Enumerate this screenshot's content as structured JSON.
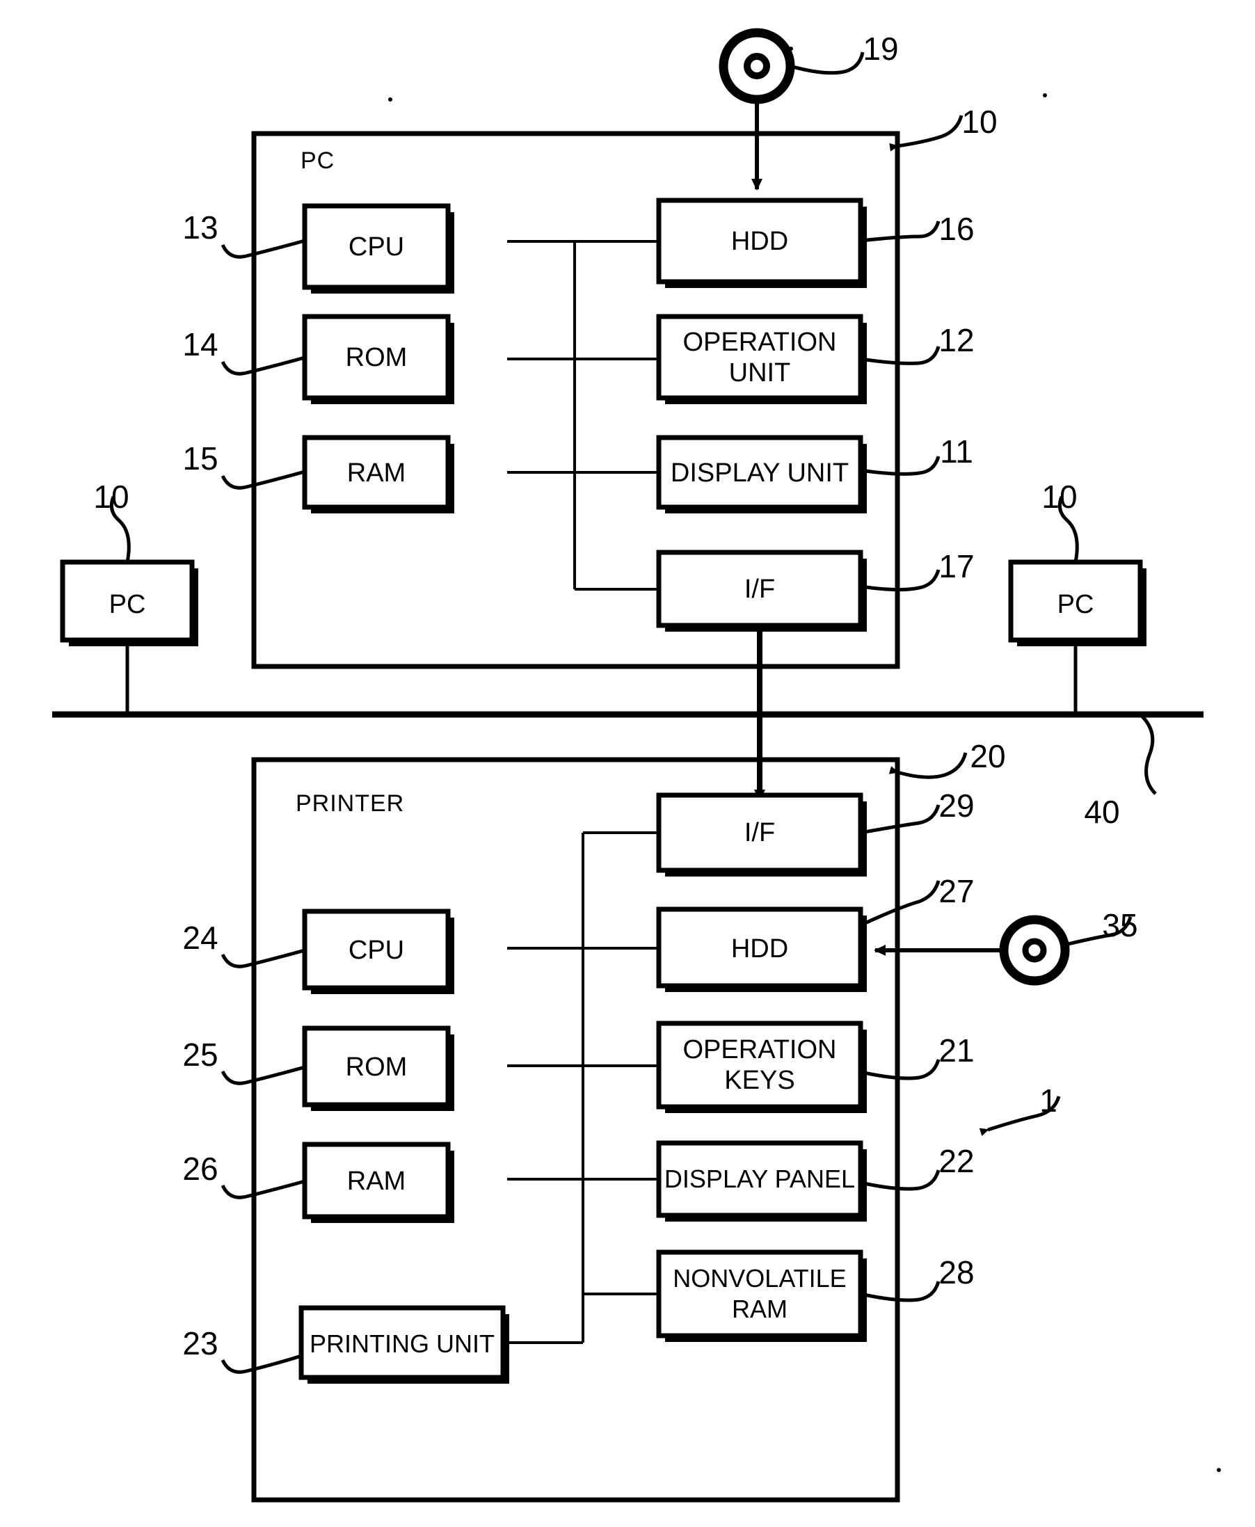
{
  "figure": {
    "type": "patent-block-diagram",
    "background_color": "#ffffff",
    "line_color": "#000000",
    "system_ref": "1",
    "network": {
      "label": "40",
      "name": "network-bus-line"
    }
  },
  "pc_host": {
    "section_label": "PC",
    "ref": "10",
    "blocks": [
      {
        "id": "cpu",
        "label": "CPU",
        "ref": "13",
        "ref_side": "left"
      },
      {
        "id": "rom",
        "label": "ROM",
        "ref": "14",
        "ref_side": "left"
      },
      {
        "id": "ram",
        "label": "RAM",
        "ref": "15",
        "ref_side": "left"
      },
      {
        "id": "hdd",
        "label": "HDD",
        "ref": "16",
        "ref_side": "right"
      },
      {
        "id": "opunit",
        "label": "OPERATION UNIT",
        "ref": "12",
        "ref_side": "right"
      },
      {
        "id": "disp",
        "label": "DISPLAY UNIT",
        "ref": "11",
        "ref_side": "right"
      },
      {
        "id": "if",
        "label": "I/F",
        "ref": "17",
        "ref_side": "right"
      }
    ],
    "media": {
      "ref": "19",
      "icon": "storage-medium-disc-icon",
      "target": "HDD"
    }
  },
  "pc_left": {
    "label": "PC",
    "ref": "10"
  },
  "pc_right": {
    "label": "PC",
    "ref": "10"
  },
  "printer": {
    "section_label": "PRINTER",
    "ref": "20",
    "blocks": [
      {
        "id": "if",
        "label": "I/F",
        "ref": "29",
        "ref_side": "right"
      },
      {
        "id": "hdd",
        "label": "HDD",
        "ref": "27",
        "ref_side": "right"
      },
      {
        "id": "opkeys",
        "label": "OPERATION KEYS",
        "ref": "21",
        "ref_side": "right"
      },
      {
        "id": "panel",
        "label": "DISPLAY PANEL",
        "ref": "22",
        "ref_side": "right"
      },
      {
        "id": "nvram",
        "label": "NONVOLATILE RAM",
        "ref": "28",
        "ref_side": "right"
      },
      {
        "id": "cpu",
        "label": "CPU",
        "ref": "24",
        "ref_side": "left"
      },
      {
        "id": "rom",
        "label": "ROM",
        "ref": "25",
        "ref_side": "left"
      },
      {
        "id": "ram",
        "label": "RAM",
        "ref": "26",
        "ref_side": "left"
      },
      {
        "id": "print",
        "label": "PRINTING UNIT",
        "ref": "23",
        "ref_side": "left"
      }
    ],
    "media": {
      "ref": "35",
      "icon": "storage-medium-disc-icon",
      "target": "HDD"
    }
  }
}
